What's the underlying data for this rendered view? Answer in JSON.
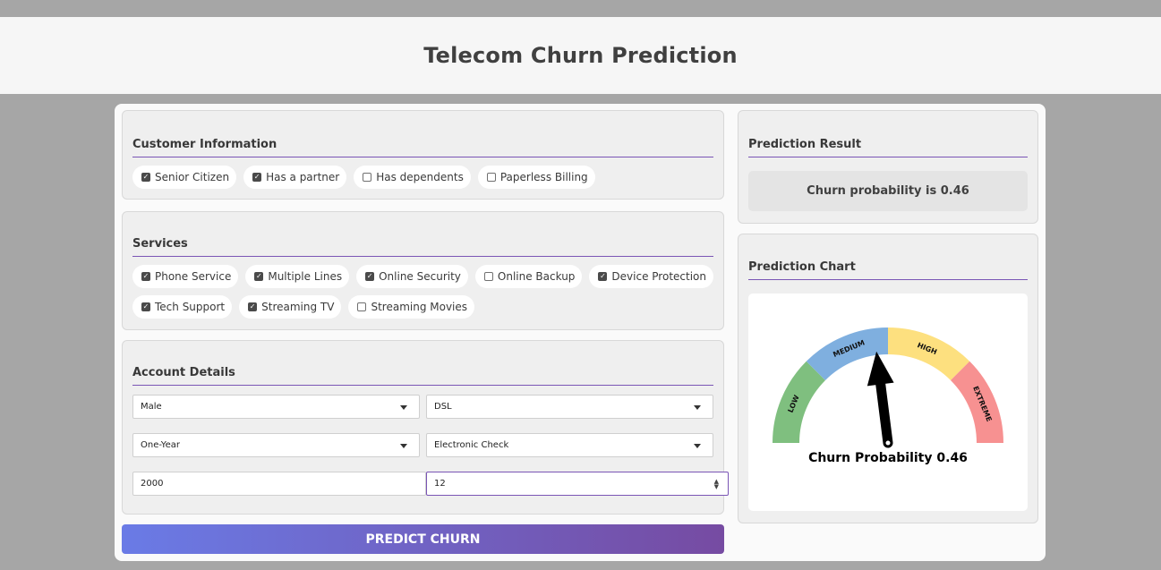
{
  "header": {
    "title": "Telecom Churn Prediction"
  },
  "customer_info": {
    "title": "Customer Information",
    "options": [
      {
        "label": "Senior Citizen",
        "checked": true
      },
      {
        "label": "Has a partner",
        "checked": true
      },
      {
        "label": "Has dependents",
        "checked": false
      },
      {
        "label": "Paperless Billing",
        "checked": false
      }
    ]
  },
  "services": {
    "title": "Services",
    "options": [
      {
        "label": "Phone Service",
        "checked": true
      },
      {
        "label": "Multiple Lines",
        "checked": true
      },
      {
        "label": "Online Security",
        "checked": true
      },
      {
        "label": "Online Backup",
        "checked": false
      },
      {
        "label": "Device Protection",
        "checked": true
      },
      {
        "label": "Tech Support",
        "checked": true
      },
      {
        "label": "Streaming TV",
        "checked": true
      },
      {
        "label": "Streaming Movies",
        "checked": false
      }
    ]
  },
  "account": {
    "title": "Account Details",
    "gender": "Male",
    "internet_service": "DSL",
    "contract": "One-Year",
    "payment_method": "Electronic Check",
    "total_charges": "2000",
    "tenure": "12"
  },
  "predict_button": "PREDICT CHURN",
  "result": {
    "title": "Prediction Result",
    "text": "Churn probability is 0.46"
  },
  "chart": {
    "title": "Prediction Chart",
    "gauge_label": "Churn Probability 0.46",
    "value": 0.46,
    "zones": [
      {
        "label": "LOW",
        "color": "#7fbf7f"
      },
      {
        "label": "MEDIUM",
        "color": "#7fafdf"
      },
      {
        "label": "HIGH",
        "color": "#fde07f"
      },
      {
        "label": "EXTREME",
        "color": "#f79191"
      }
    ]
  }
}
